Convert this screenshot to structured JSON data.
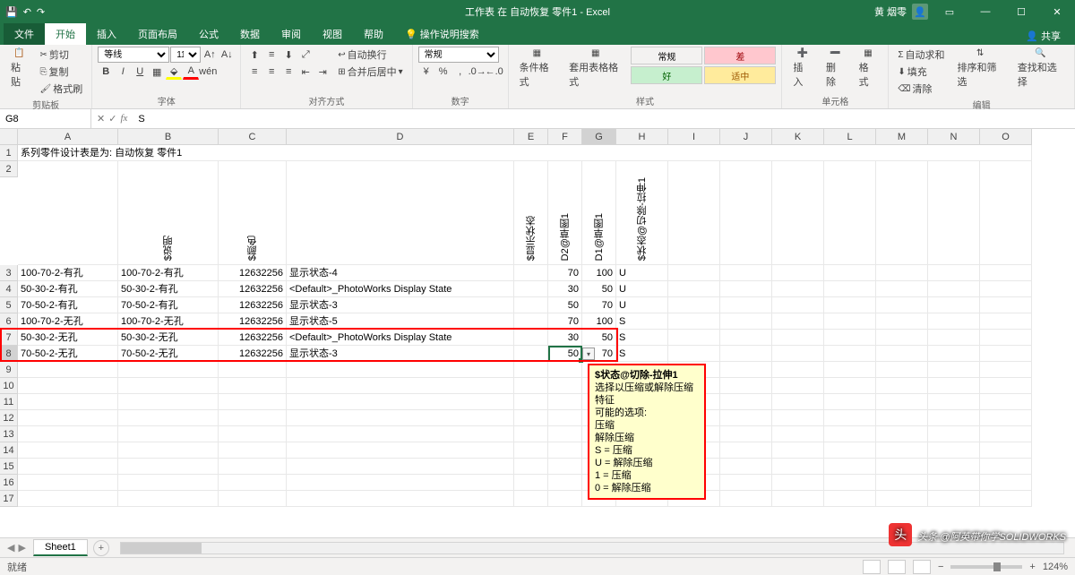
{
  "title": "工作表 在 自动恢复 零件1 - Excel",
  "user_name": "黄 烟零",
  "tabs": {
    "file": "文件",
    "home": "开始",
    "insert": "插入",
    "layout": "页面布局",
    "formulas": "公式",
    "data": "数据",
    "review": "审阅",
    "view": "视图",
    "help": "帮助",
    "tellme": "操作说明搜索",
    "share": "共享"
  },
  "ribbon": {
    "clipboard": {
      "paste": "粘贴",
      "cut": "剪切",
      "copy": "复制",
      "painter": "格式刷",
      "label": "剪贴板"
    },
    "font": {
      "name": "等线",
      "size": "11",
      "label": "字体"
    },
    "align": {
      "wrap": "自动换行",
      "merge": "合并后居中",
      "label": "对齐方式"
    },
    "number": {
      "format": "常规",
      "label": "数字"
    },
    "styles": {
      "cond": "条件格式",
      "table": "套用表格格式",
      "normal": "常规",
      "bad": "差",
      "good": "好",
      "neutral": "适中",
      "label": "样式"
    },
    "cells": {
      "insert": "插入",
      "delete": "删除",
      "format": "格式",
      "label": "单元格"
    },
    "editing": {
      "sum": "自动求和",
      "fill": "填充",
      "clear": "清除",
      "sort": "排序和筛选",
      "find": "查找和选择",
      "label": "编辑"
    }
  },
  "namebox": "G8",
  "formula": "S",
  "cols": [
    "A",
    "B",
    "C",
    "D",
    "E",
    "F",
    "G",
    "H",
    "I",
    "J",
    "K",
    "L",
    "M",
    "N",
    "O"
  ],
  "row1": "系列零件设计表是为:    自动恢复 零件1",
  "headers2": {
    "B": "$说明",
    "C": "$颜色",
    "D": "",
    "E": "$显示状态",
    "F": "D2@草图1",
    "G": "D1@草图1",
    "H_like": "$状态@切除-拉伸1"
  },
  "rows": [
    {
      "n": 3,
      "A": "100-70-2-有孔",
      "B": "100-70-2-有孔",
      "C": "12632256",
      "D": "显示状态-4",
      "E": "",
      "F": "70",
      "G": "100",
      "H": "U"
    },
    {
      "n": 4,
      "A": "50-30-2-有孔",
      "B": "50-30-2-有孔",
      "C": "12632256",
      "D": "<Default>_PhotoWorks Display State",
      "E": "",
      "F": "30",
      "G": "50",
      "H": "U"
    },
    {
      "n": 5,
      "A": "70-50-2-有孔",
      "B": "70-50-2-有孔",
      "C": "12632256",
      "D": "显示状态-3",
      "E": "",
      "F": "50",
      "G": "70",
      "H": "U"
    },
    {
      "n": 6,
      "A": "100-70-2-无孔",
      "B": "100-70-2-无孔",
      "C": "12632256",
      "D": "显示状态-5",
      "E": "",
      "F": "70",
      "G": "100",
      "H": "S"
    },
    {
      "n": 7,
      "A": "50-30-2-无孔",
      "B": "50-30-2-无孔",
      "C": "12632256",
      "D": "<Default>_PhotoWorks Display State",
      "E": "",
      "F": "30",
      "G": "50",
      "H": "S"
    },
    {
      "n": 8,
      "A": "70-50-2-无孔",
      "B": "70-50-2-无孔",
      "C": "12632256",
      "D": "显示状态-3",
      "E": "",
      "F": "50",
      "G": "70",
      "H": "S"
    }
  ],
  "empty_rows": [
    9,
    10,
    11,
    12,
    13,
    14,
    15,
    16,
    17
  ],
  "tooltip": {
    "title": "$状态@切除-拉伸1",
    "line1": "选择以压缩或解除压缩特征",
    "line2": "可能的选项:",
    "o1": "压缩",
    "o2": "解除压缩",
    "o3": "S = 压缩",
    "o4": "U = 解除压缩",
    "o5": "1 = 压缩",
    "o6": "0 = 解除压缩"
  },
  "sheet_tab": "Sheet1",
  "status_ready": "就绪",
  "zoom": "124%",
  "watermark_text": "头条 @阿英带你学SOLIDWORKS"
}
